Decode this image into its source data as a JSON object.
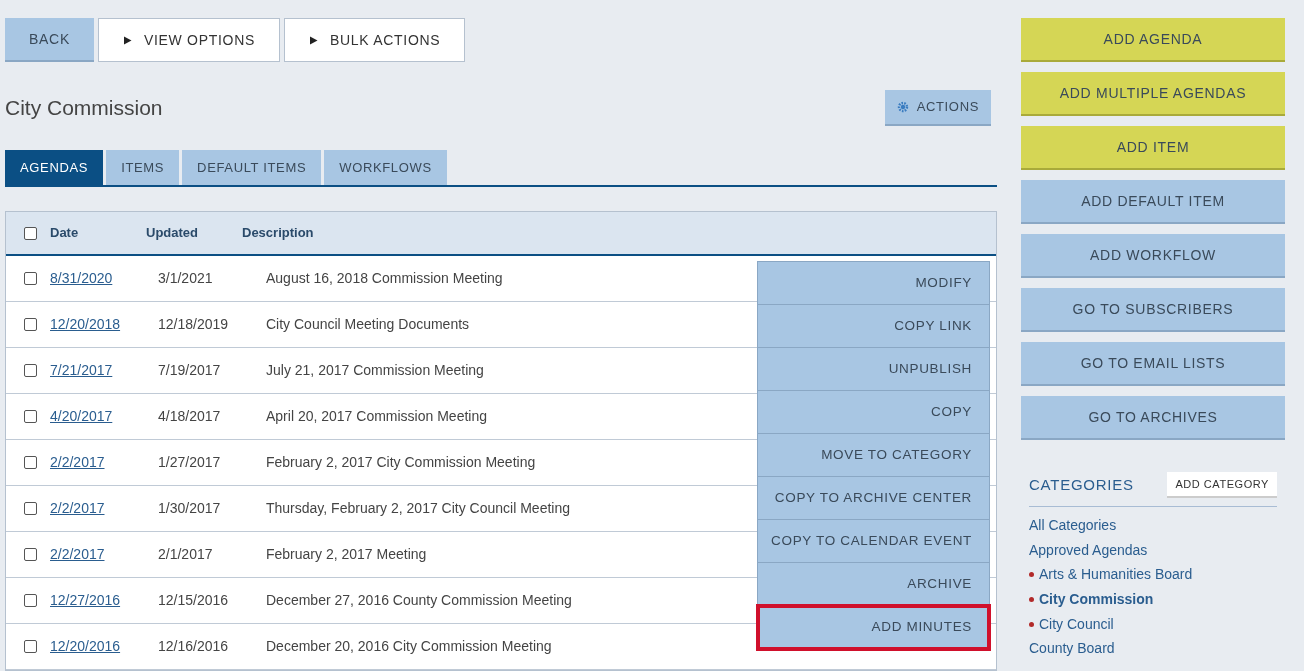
{
  "toolbar": [
    {
      "label": "BACK",
      "kind": "primary",
      "arrow": false
    },
    {
      "label": "VIEW OPTIONS",
      "kind": "outline",
      "arrow": true
    },
    {
      "label": "BULK ACTIONS",
      "kind": "outline",
      "arrow": true
    }
  ],
  "title": "City Commission",
  "actions_button": "ACTIONS",
  "tabs": [
    {
      "label": "AGENDAS",
      "selected": true
    },
    {
      "label": "ITEMS",
      "selected": false
    },
    {
      "label": "DEFAULT ITEMS",
      "selected": false
    },
    {
      "label": "WORKFLOWS",
      "selected": false
    }
  ],
  "table": {
    "select_all": {
      "checked": false
    },
    "columns": [
      "Date",
      "Updated",
      "Description"
    ],
    "rows": [
      {
        "checked": false,
        "date": "8/31/2020",
        "updated": "3/1/2021",
        "description": "August 16, 2018 Commission Meeting"
      },
      {
        "checked": false,
        "date": "12/20/2018",
        "updated": "12/18/2019",
        "description": "City Council Meeting Documents"
      },
      {
        "checked": false,
        "date": "7/21/2017",
        "updated": "7/19/2017",
        "description": "July 21, 2017 Commission Meeting"
      },
      {
        "checked": false,
        "date": "4/20/2017",
        "updated": "4/18/2017",
        "description": "April 20, 2017 Commission Meeting"
      },
      {
        "checked": false,
        "date": "2/2/2017",
        "updated": "1/27/2017",
        "description": "February 2, 2017 City Commission Meeting"
      },
      {
        "checked": false,
        "date": "2/2/2017",
        "updated": "1/30/2017",
        "description": "Thursday, February 2, 2017 City Council Meeting"
      },
      {
        "checked": false,
        "date": "2/2/2017",
        "updated": "2/1/2017",
        "description": "February 2, 2017 Meeting"
      },
      {
        "checked": false,
        "date": "12/27/2016",
        "updated": "12/15/2016",
        "description": "December 27, 2016 County Commission Meeting"
      },
      {
        "checked": false,
        "date": "12/20/2016",
        "updated": "12/16/2016",
        "description": "December 20, 2016 City Commission Meeting"
      }
    ]
  },
  "menu": [
    {
      "label": "MODIFY",
      "highlighted": false
    },
    {
      "label": "COPY LINK",
      "highlighted": false
    },
    {
      "label": "UNPUBLISH",
      "highlighted": false
    },
    {
      "label": "COPY",
      "highlighted": false
    },
    {
      "label": "MOVE TO CATEGORY",
      "highlighted": false
    },
    {
      "label": "COPY TO ARCHIVE CENTER",
      "highlighted": false
    },
    {
      "label": "COPY TO CALENDAR EVENT",
      "highlighted": false
    },
    {
      "label": "ARCHIVE",
      "highlighted": false
    },
    {
      "label": "ADD MINUTES",
      "highlighted": true
    }
  ],
  "sidebar_buttons": [
    {
      "label": "ADD AGENDA",
      "kind": "primary"
    },
    {
      "label": "ADD MULTIPLE AGENDAS",
      "kind": "primary"
    },
    {
      "label": "ADD ITEM",
      "kind": "primary"
    },
    {
      "label": "ADD DEFAULT ITEM",
      "kind": "secondary"
    },
    {
      "label": "ADD WORKFLOW",
      "kind": "secondary"
    },
    {
      "label": "GO TO SUBSCRIBERS",
      "kind": "secondary"
    },
    {
      "label": "GO TO EMAIL LISTS",
      "kind": "secondary"
    },
    {
      "label": "GO TO ARCHIVES",
      "kind": "secondary"
    }
  ],
  "categories": {
    "heading": "CATEGORIES",
    "add_button": "ADD CATEGORY",
    "items": [
      {
        "label": "All Categories",
        "bullet": false,
        "selected": false
      },
      {
        "label": "Approved Agendas",
        "bullet": false,
        "selected": false
      },
      {
        "label": "Arts & Humanities Board",
        "bullet": true,
        "selected": false
      },
      {
        "label": "City Commission",
        "bullet": true,
        "selected": true
      },
      {
        "label": "City Council",
        "bullet": true,
        "selected": false
      },
      {
        "label": "County Board",
        "bullet": false,
        "selected": false
      }
    ]
  }
}
